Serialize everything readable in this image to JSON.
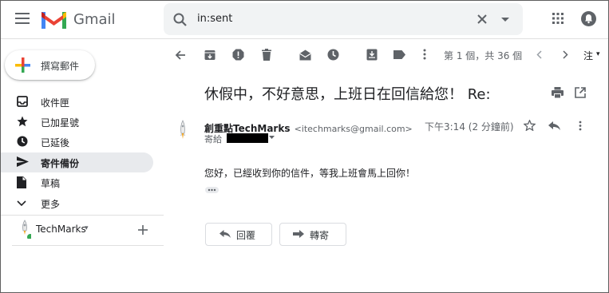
{
  "header": {
    "app_name": "Gmail",
    "search_value": "in:sent"
  },
  "sidebar": {
    "compose_label": "撰寫郵件",
    "items": [
      {
        "label": "收件匣"
      },
      {
        "label": "已加星號"
      },
      {
        "label": "已延後"
      },
      {
        "label": "寄件備份"
      },
      {
        "label": "草稿"
      },
      {
        "label": "更多"
      }
    ],
    "account_name": "TechMarks",
    "account_caret": "▾"
  },
  "toolbar": {
    "pager": "第 1 個，共 36 個",
    "more_label": "注",
    "more_caret": "▾"
  },
  "message": {
    "subject": "休假中，不好意思，上班日在回信給您！ Re:",
    "sender_name": "創重點TechMarks",
    "sender_email": "<itechmarks@gmail.com>",
    "time": "下午3:14 (2 分鐘前)",
    "to_label": "寄給",
    "body": "您好，已經收到你的信件，等我上班會馬上回你！",
    "reply_label": "回覆",
    "forward_label": "轉寄"
  },
  "colors": {
    "gmail_red": "#EA4335",
    "active_nav_bg": "#e8eaed",
    "icon_gray": "#5f6368"
  }
}
